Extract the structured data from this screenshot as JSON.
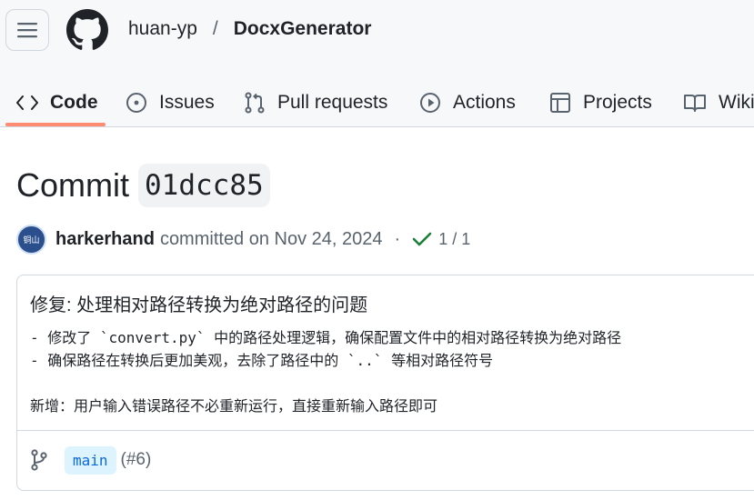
{
  "header": {
    "owner": "huan-yp",
    "separator": "/",
    "repo": "DocxGenerator"
  },
  "tabs": [
    {
      "label": "Code",
      "icon": "code-icon",
      "selected": true
    },
    {
      "label": "Issues",
      "icon": "issue-opened-icon",
      "selected": false
    },
    {
      "label": "Pull requests",
      "icon": "git-pull-request-icon",
      "selected": false
    },
    {
      "label": "Actions",
      "icon": "play-icon",
      "selected": false
    },
    {
      "label": "Projects",
      "icon": "table-icon",
      "selected": false
    },
    {
      "label": "Wiki",
      "icon": "book-icon",
      "selected": false
    }
  ],
  "commit": {
    "word": "Commit",
    "sha": "01dcc85",
    "author": "harkerhand",
    "verb": "committed on Nov 24, 2024",
    "separator": "·",
    "checks": "1 / 1",
    "avatar_text": "铜山",
    "message_title": "修复: 处理相对路径转换为绝对路径的问题",
    "message_body": "- 修改了 `convert.py` 中的路径处理逻辑，确保配置文件中的相对路径转换为绝对路径\n- 确保路径在转换后更加美观，去除了路径中的 `..` 等相对路径符号\n\n新增：用户输入错误路径不必重新运行，直接重新输入路径即可",
    "branch": "main",
    "pr_ref": "(#6)"
  },
  "colors": {
    "accent_underline": "#fd8c73",
    "success": "#1a7f37",
    "link": "#0969da",
    "branch_bg": "#ddf4ff"
  }
}
